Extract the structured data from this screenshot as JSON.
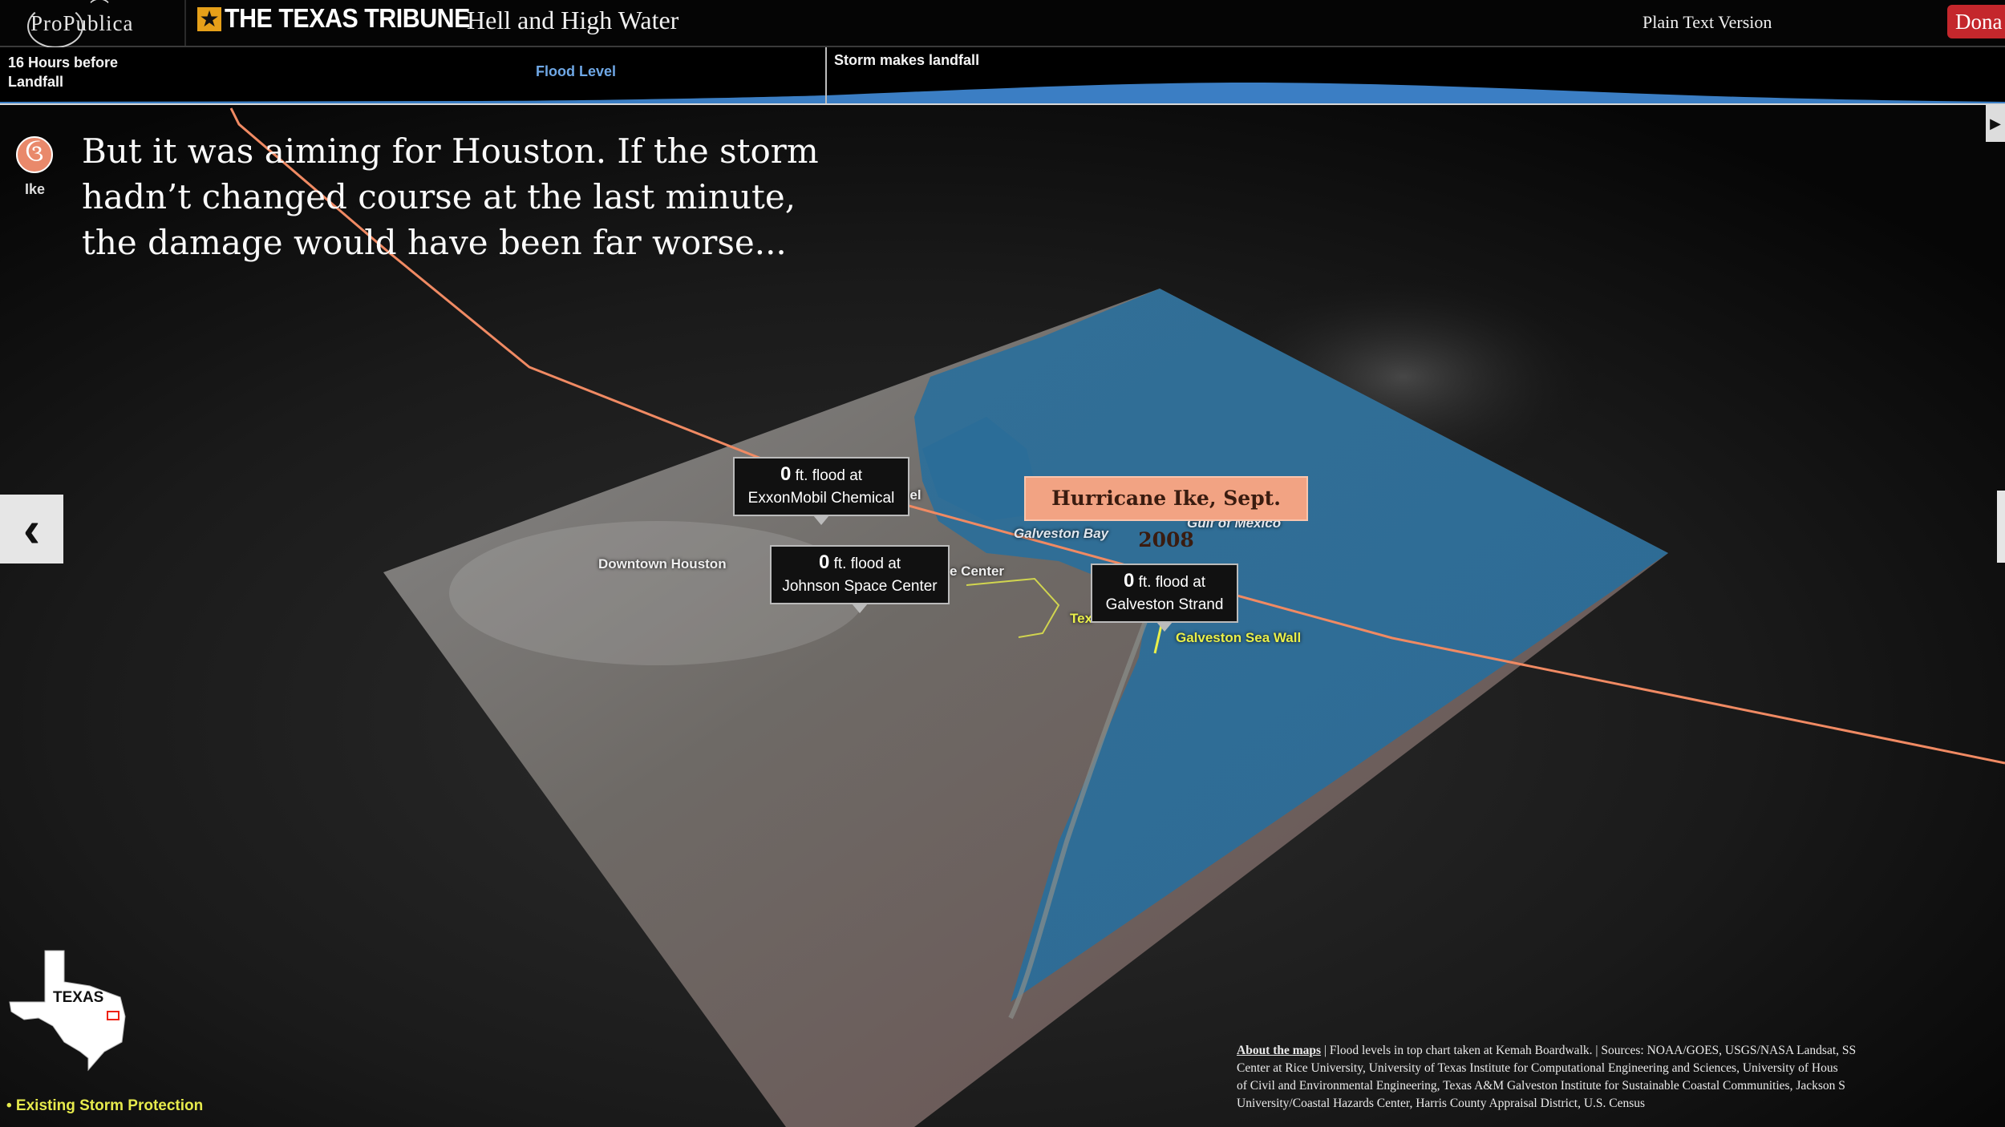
{
  "header": {
    "propublica_logo_text": "ProPublica",
    "tribune_logo_text": "THE TEXAS TRIBUNE",
    "site_title": "Hell and High Water",
    "plain_text_link": "Plain Text Version",
    "donate_label": "Dona"
  },
  "timeline": {
    "start_label": "16 Hours before Landfall",
    "flood_level_label": "Flood Level",
    "landfall_label": "Storm makes landfall"
  },
  "story": {
    "icon_label": "Ike",
    "text": "But it was aiming for Houston. If the storm hadn’t changed course at the last minute, the damage would have been far worse..."
  },
  "map": {
    "labels": {
      "downtown_houston": "Downtown Houston",
      "galveston_bay": "Galveston Bay",
      "gulf_of_mexico": "Gulf of Mexico",
      "space_center_partial": "e Center",
      "channel_partial": "nel",
      "texas_city_partial": "Tex",
      "galveston_sea_wall": "Galveston Sea Wall"
    },
    "callouts": [
      {
        "number": "0",
        "line1": "ft. flood at",
        "line2": "ExxonMobil Chemical"
      },
      {
        "number": "0",
        "line1": "ft. flood at",
        "line2": "Johnson Space Center"
      },
      {
        "number": "0",
        "line1": "ft. flood at",
        "line2": "Galveston Strand"
      }
    ],
    "hurricane_label": "Hurricane Ike, Sept. 2008",
    "colors": {
      "water": "#2d6f9c",
      "track": "#f08a63",
      "protection": "#eaf04a"
    }
  },
  "inset": {
    "state_label": "TEXAS"
  },
  "legend": {
    "storm_protection": "• Existing Storm Protection"
  },
  "sources": {
    "lead": "About the maps",
    "text": "| Flood levels in top chart taken at Kemah Boardwalk. | Sources: NOAA/GOES, USGS/NASA Landsat, SS\nCenter at Rice University, University of Texas Institute for Computational Engineering and Sciences, University of Hous\nof Civil and Environmental Engineering, Texas A&M Galveston Institute for Sustainable Coastal Communities, Jackson S\nUniversity/Coastal Hazards Center, Harris County Appraisal District, U.S. Census"
  }
}
